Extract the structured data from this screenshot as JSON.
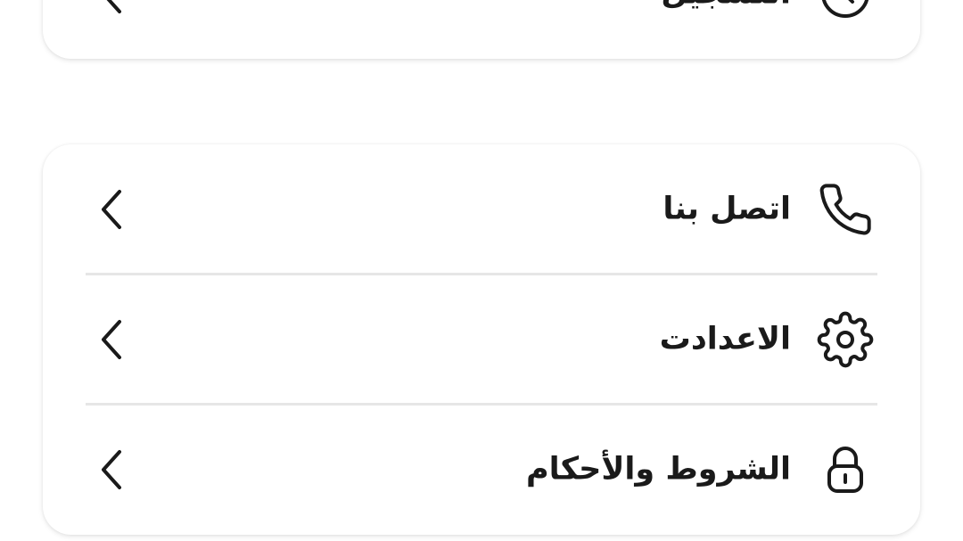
{
  "menu": {
    "top_item": {
      "label": "التسجيل",
      "icon": "clock-icon"
    },
    "items": [
      {
        "label": "اتصل بنا",
        "icon": "phone-icon"
      },
      {
        "label": "الاعدادت",
        "icon": "gear-icon"
      },
      {
        "label": "الشروط والأحكام",
        "icon": "lock-icon"
      }
    ]
  },
  "colors": {
    "text": "#1a1a1a",
    "divider": "#e6e6e6",
    "card_background": "#ffffff"
  }
}
